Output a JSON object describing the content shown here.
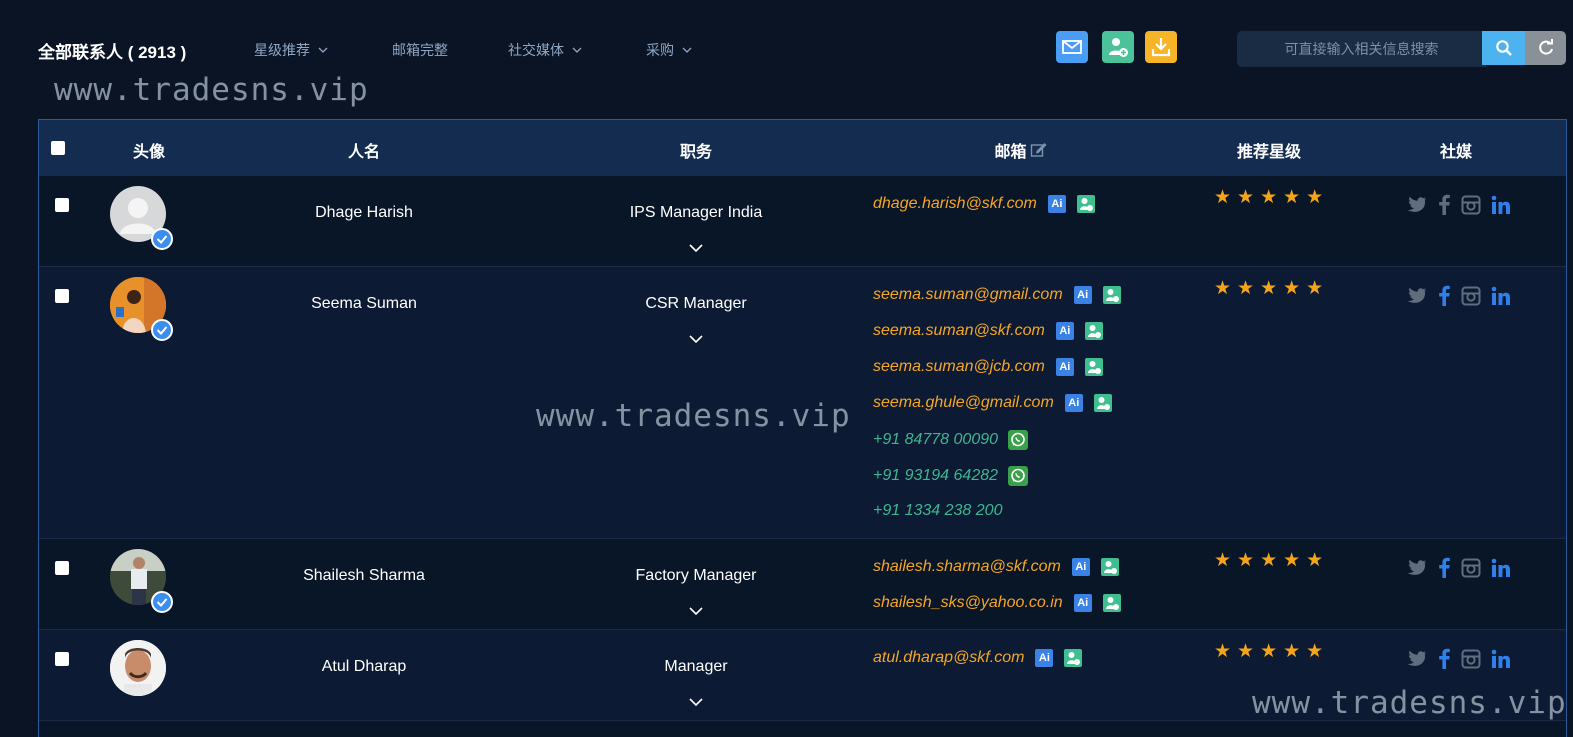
{
  "header": {
    "title": "全部联系人 ( 2913 )",
    "nav": [
      {
        "label": "星级推荐",
        "has_dropdown": true
      },
      {
        "label": "邮箱完整",
        "has_dropdown": false
      },
      {
        "label": "社交媒体",
        "has_dropdown": true
      },
      {
        "label": "采购",
        "has_dropdown": true
      }
    ],
    "tools": [
      "mail-icon",
      "add-user-icon",
      "download-icon"
    ],
    "search": {
      "placeholder": "可直接输入相关信息搜索",
      "value": ""
    }
  },
  "watermark": "www.tradesns.vip",
  "table": {
    "columns": [
      "头像",
      "人名",
      "职务",
      "邮箱",
      "推荐星级",
      "社媒"
    ],
    "rows": [
      {
        "name": "Dhage Harish",
        "job": "IPS Manager India",
        "avatar": "placeholder",
        "verified": true,
        "contacts": [
          {
            "type": "email",
            "text": "dhage.harish@skf.com"
          }
        ],
        "rating": 5,
        "facebook_active": false
      },
      {
        "name": "Seema Suman",
        "job": "CSR Manager",
        "avatar": "photo",
        "verified": true,
        "contacts": [
          {
            "type": "email",
            "text": "seema.suman@gmail.com"
          },
          {
            "type": "email",
            "text": "seema.suman@skf.com"
          },
          {
            "type": "email",
            "text": "seema.suman@jcb.com"
          },
          {
            "type": "email",
            "text": "seema.ghule@gmail.com"
          },
          {
            "type": "phone",
            "text": "+91 84778 00090",
            "whatsapp": true
          },
          {
            "type": "phone",
            "text": "+91 93194 64282",
            "whatsapp": true
          },
          {
            "type": "phone",
            "text": "+91 1334 238 200",
            "whatsapp": false
          }
        ],
        "rating": 5,
        "facebook_active": true
      },
      {
        "name": "Shailesh Sharma",
        "job": "Factory Manager",
        "avatar": "photo",
        "verified": true,
        "contacts": [
          {
            "type": "email",
            "text": "shailesh.sharma@skf.com"
          },
          {
            "type": "email",
            "text": "shailesh_sks@yahoo.co.in"
          }
        ],
        "rating": 5,
        "facebook_active": true
      },
      {
        "name": "Atul Dharap",
        "job": "Manager",
        "avatar": "photo",
        "verified": false,
        "contacts": [
          {
            "type": "email",
            "text": "atul.dharap@skf.com"
          }
        ],
        "rating": 5,
        "facebook_active": true
      }
    ]
  },
  "colors": {
    "background": "#0b1424",
    "header_row": "#132c50",
    "email": "#f5a623",
    "phone": "#3fb58f",
    "star": "#f5a41a",
    "linkedin": "#2f80ed",
    "facebook_active": "#2f80ed"
  }
}
